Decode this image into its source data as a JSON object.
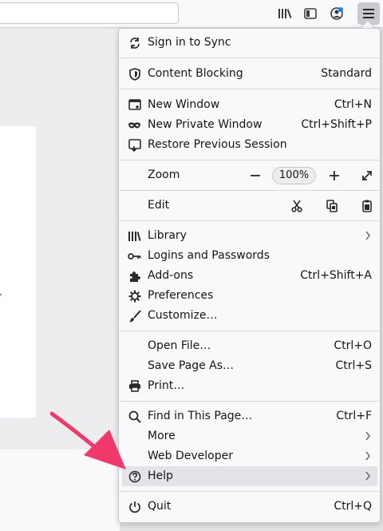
{
  "menu": {
    "sections": {
      "sync": {
        "label": "Sign in to Sync"
      },
      "content_blocking": {
        "label": "Content Blocking",
        "value": "Standard"
      },
      "new_window": {
        "label": "New Window",
        "shortcut": "Ctrl+N"
      },
      "new_private": {
        "label": "New Private Window",
        "shortcut": "Ctrl+Shift+P"
      },
      "restore": {
        "label": "Restore Previous Session"
      },
      "zoom": {
        "label": "Zoom",
        "minus": "−",
        "value": "100%",
        "plus": "+"
      },
      "edit": {
        "label": "Edit"
      },
      "library": {
        "label": "Library"
      },
      "logins": {
        "label": "Logins and Passwords"
      },
      "addons": {
        "label": "Add-ons",
        "shortcut": "Ctrl+Shift+A"
      },
      "preferences": {
        "label": "Preferences"
      },
      "customize": {
        "label": "Customize…"
      },
      "open_file": {
        "label": "Open File…",
        "shortcut": "Ctrl+O"
      },
      "save_page": {
        "label": "Save Page As…",
        "shortcut": "Ctrl+S"
      },
      "print": {
        "label": "Print…"
      },
      "find": {
        "label": "Find in This Page…",
        "shortcut": "Ctrl+F"
      },
      "more": {
        "label": "More"
      },
      "web_dev": {
        "label": "Web Developer"
      },
      "help": {
        "label": "Help"
      },
      "quit": {
        "label": "Quit",
        "shortcut": "Ctrl+Q"
      }
    }
  },
  "colors": {
    "accent_annotation": "#f0386b",
    "hover": "#e4e4e8",
    "account_blue": "#0a84ff"
  }
}
